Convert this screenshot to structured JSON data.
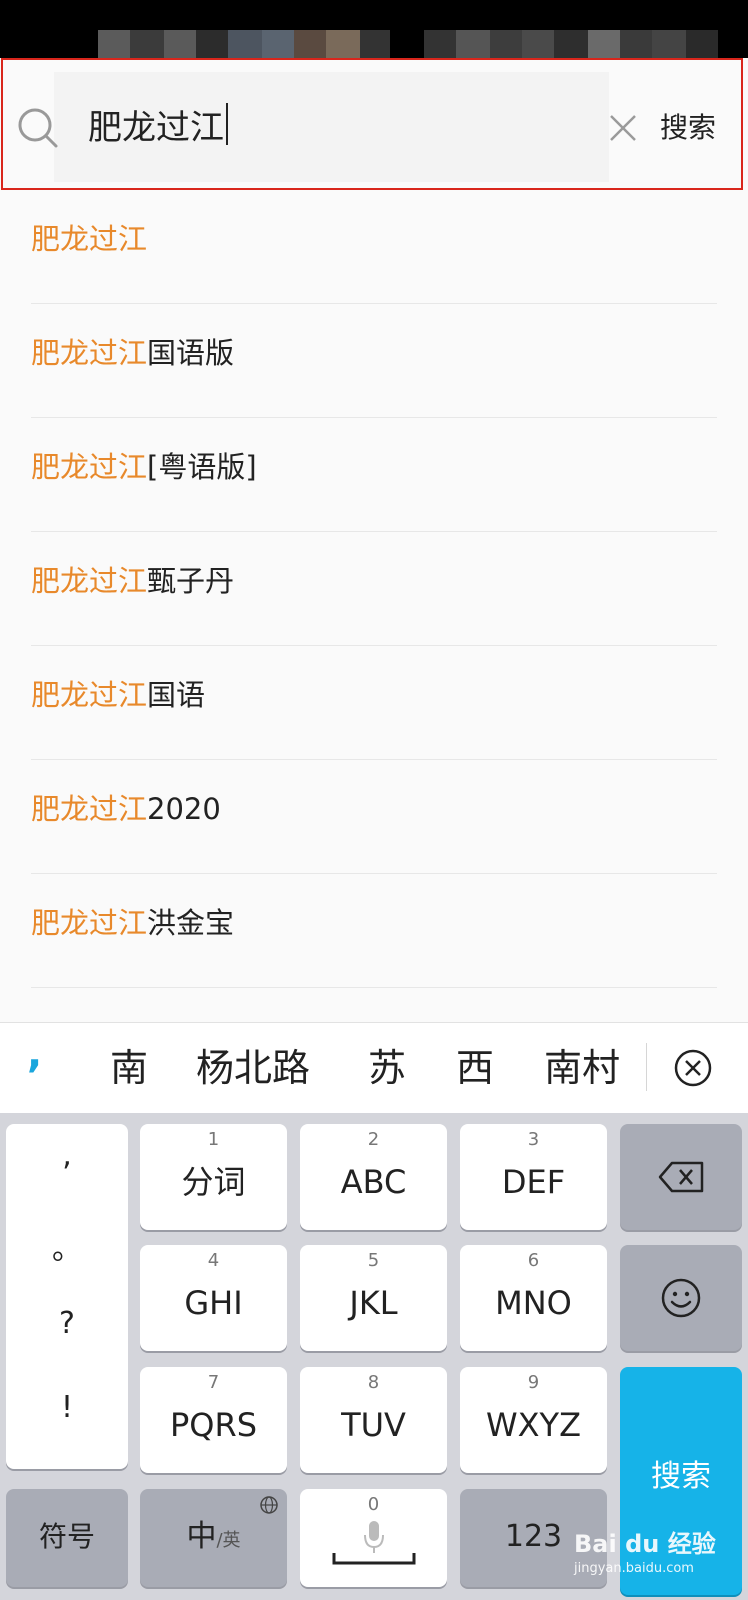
{
  "search": {
    "value": "肥龙过江",
    "submit_label": "搜索"
  },
  "suggestions": [
    {
      "highlight": "肥龙过江",
      "rest": ""
    },
    {
      "highlight": "肥龙过江",
      "rest": "国语版"
    },
    {
      "highlight": "肥龙过江",
      "rest": "[粤语版]"
    },
    {
      "highlight": "肥龙过江",
      "rest": "甄子丹"
    },
    {
      "highlight": "肥龙过江",
      "rest": "国语"
    },
    {
      "highlight": "肥龙过江",
      "rest": "2020"
    },
    {
      "highlight": "肥龙过江",
      "rest": "洪金宝"
    }
  ],
  "candidates": {
    "comma": ",",
    "items": [
      "南",
      "杨北路",
      "苏",
      "西",
      "南村"
    ]
  },
  "keyboard": {
    "punctuation": [
      ",",
      "。",
      "?",
      "!"
    ],
    "keys": [
      {
        "num": "1",
        "label": "分词"
      },
      {
        "num": "2",
        "label": "ABC"
      },
      {
        "num": "3",
        "label": "DEF"
      },
      {
        "num": "4",
        "label": "GHI"
      },
      {
        "num": "5",
        "label": "JKL"
      },
      {
        "num": "6",
        "label": "MNO"
      },
      {
        "num": "7",
        "label": "PQRS"
      },
      {
        "num": "8",
        "label": "TUV"
      },
      {
        "num": "9",
        "label": "WXYZ"
      }
    ],
    "symbols_label": "符号",
    "lang_main": "中",
    "lang_sub": "/英",
    "space_num": "0",
    "num_label": "123",
    "search_label": "搜索"
  },
  "watermark": {
    "brand": "Bai du 经验",
    "url": "jingyan.baidu.com"
  },
  "colors": {
    "highlight": "#e8892b",
    "accent": "#16b3e8",
    "frame": "#d9261c"
  }
}
